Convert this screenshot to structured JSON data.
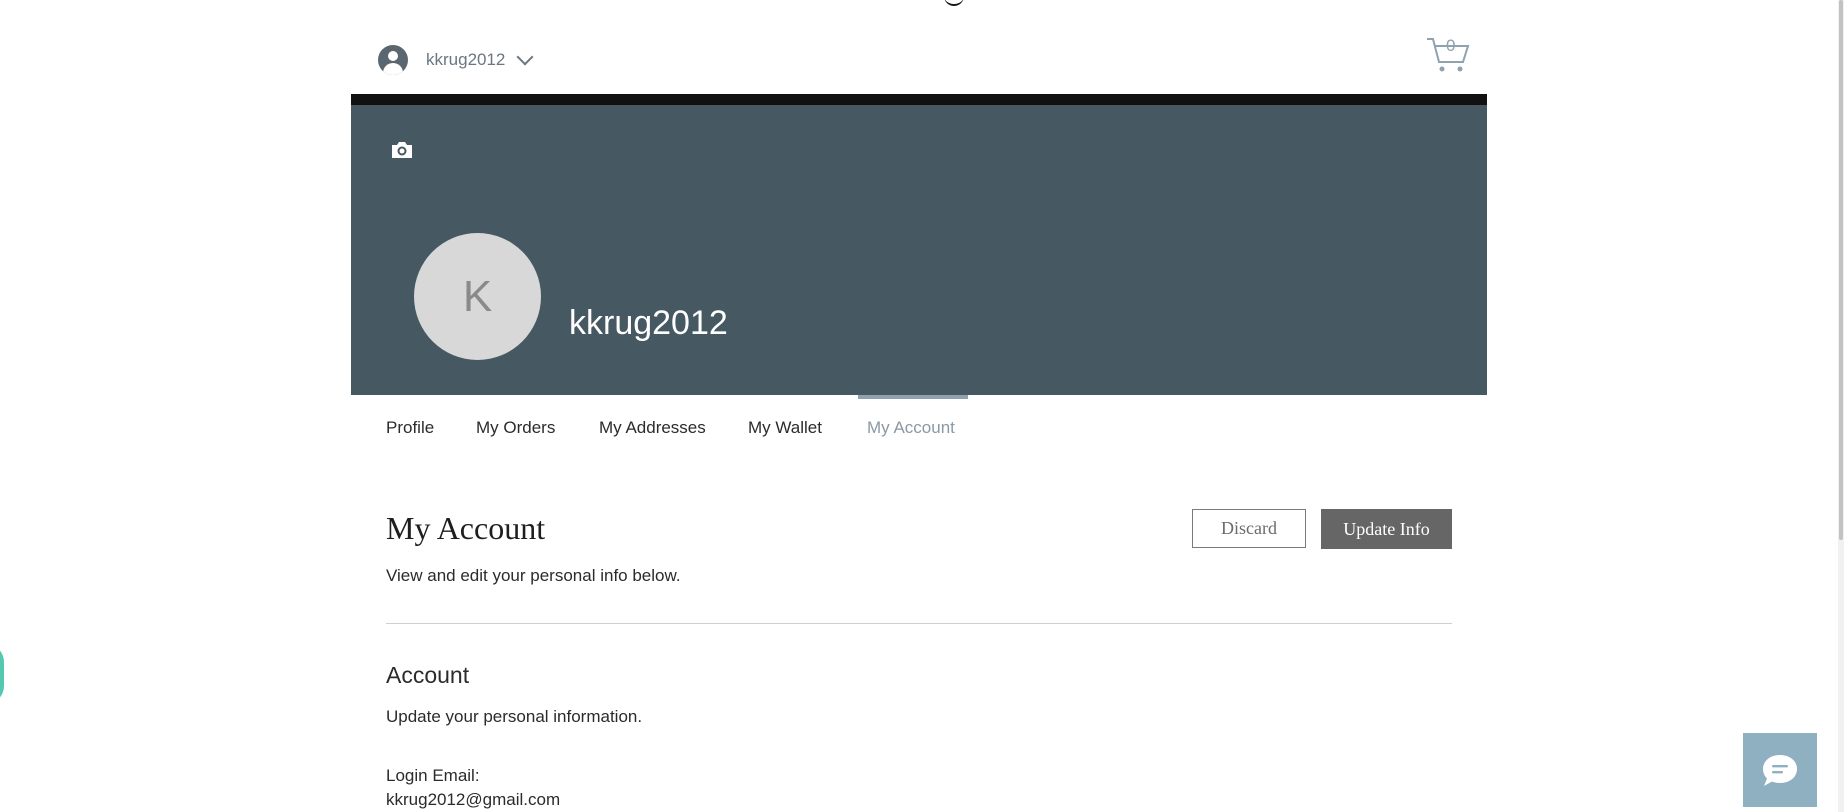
{
  "header": {
    "member_name": "kkrug2012",
    "cart_count": "0",
    "icons": {
      "avatar": "user-avatar-icon",
      "chevron": "chevron-down-icon",
      "cart": "cart-icon"
    }
  },
  "cover": {
    "avatar_initial": "K",
    "display_name": "kkrug2012",
    "camera_icon": "camera-icon",
    "background_color": "#465862"
  },
  "tabs": [
    {
      "label": "Profile",
      "active": false
    },
    {
      "label": "My Orders",
      "active": false
    },
    {
      "label": "My Addresses",
      "active": false
    },
    {
      "label": "My Wallet",
      "active": false
    },
    {
      "label": "My Account",
      "active": true
    }
  ],
  "account": {
    "title": "My Account",
    "subtitle": "View and edit your personal info below.",
    "discard_label": "Discard",
    "update_label": "Update Info",
    "section_heading": "Account",
    "section_subtitle": "Update your personal information.",
    "login_email_label": "Login Email:",
    "login_email_value": "kkrug2012@gmail.com"
  },
  "chat": {
    "icon": "chat-bubble-icon"
  },
  "colors": {
    "accent": "#8ea2b0",
    "update_button": "#666666",
    "chat_button": "#8fb0c1"
  }
}
